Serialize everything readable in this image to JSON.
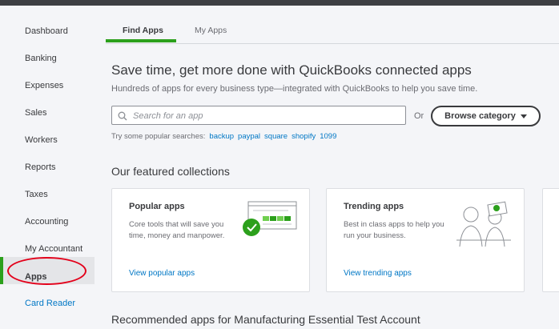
{
  "sidebar": {
    "items": [
      {
        "label": "Dashboard"
      },
      {
        "label": "Banking"
      },
      {
        "label": "Expenses"
      },
      {
        "label": "Sales"
      },
      {
        "label": "Workers"
      },
      {
        "label": "Reports"
      },
      {
        "label": "Taxes"
      },
      {
        "label": "Accounting"
      },
      {
        "label": "My Accountant"
      },
      {
        "label": "Apps"
      },
      {
        "label": "Card Reader"
      }
    ]
  },
  "tabs": [
    {
      "label": "Find Apps"
    },
    {
      "label": "My Apps"
    }
  ],
  "main": {
    "headline": "Save time, get more done with QuickBooks connected apps",
    "subline": "Hundreds of apps for every business type—integrated with QuickBooks to help you save time.",
    "search": {
      "placeholder": "Search for an app"
    },
    "or_label": "Or",
    "browse_label": "Browse category",
    "popular": {
      "label": "Try some popular searches:",
      "terms": [
        "backup",
        "paypal",
        "square",
        "shopify",
        "1099"
      ]
    },
    "featured_title": "Our featured collections",
    "cards": [
      {
        "title": "Popular apps",
        "description": "Core tools that will save you time, money and manpower.",
        "link": "View popular apps"
      },
      {
        "title": "Trending apps",
        "description": "Best in class apps to help you run your business.",
        "link": "View trending apps"
      }
    ],
    "recommended_title": "Recommended apps for Manufacturing Essential Test Account"
  },
  "colors": {
    "accent_green": "#2ca01c",
    "link_blue": "#0077c5",
    "highlight_red": "#e3001a"
  }
}
